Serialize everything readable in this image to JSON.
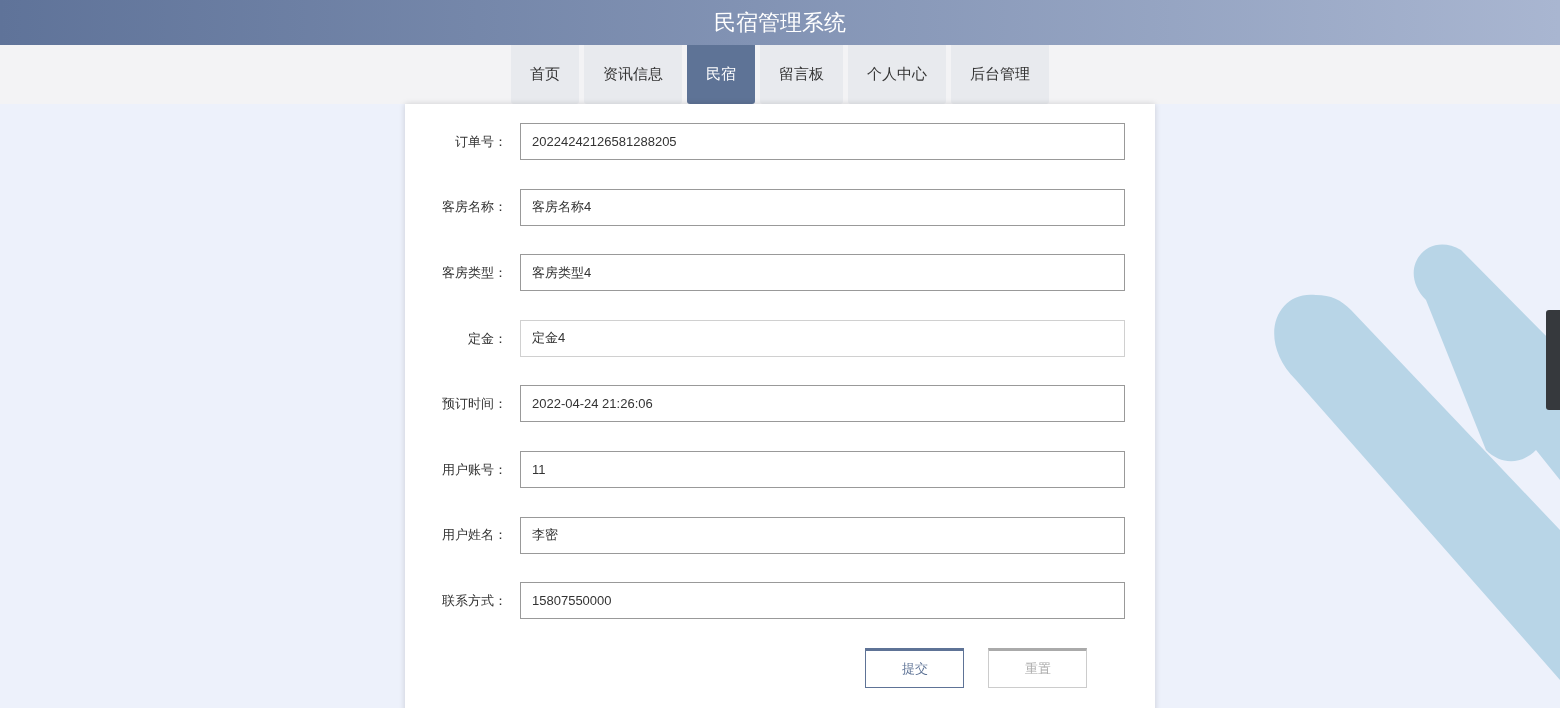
{
  "header": {
    "title": "民宿管理系统"
  },
  "nav": [
    {
      "label": "首页",
      "selected": false
    },
    {
      "label": "资讯信息",
      "selected": false
    },
    {
      "label": "民宿",
      "selected": true
    },
    {
      "label": "留言板",
      "selected": false
    },
    {
      "label": "个人中心",
      "selected": false
    },
    {
      "label": "后台管理",
      "selected": false
    }
  ],
  "form": {
    "fields": [
      {
        "label": "订单号：",
        "value": "20224242126581288205",
        "hovered": false
      },
      {
        "label": "客房名称：",
        "value": "客房名称4",
        "hovered": false
      },
      {
        "label": "客房类型：",
        "value": "客房类型4",
        "hovered": false
      },
      {
        "label": "定金：",
        "value": "定金4",
        "hovered": true
      },
      {
        "label": "预订时间：",
        "value": "2022-04-24 21:26:06",
        "hovered": false
      },
      {
        "label": "用户账号：",
        "value": "11",
        "hovered": false
      },
      {
        "label": "用户姓名：",
        "value": "李密",
        "hovered": false
      },
      {
        "label": "联系方式：",
        "value": "15807550000",
        "hovered": false
      }
    ],
    "buttons": [
      {
        "label": "提交",
        "kind": "primary"
      },
      {
        "label": "重置",
        "kind": "secondary"
      }
    ]
  }
}
